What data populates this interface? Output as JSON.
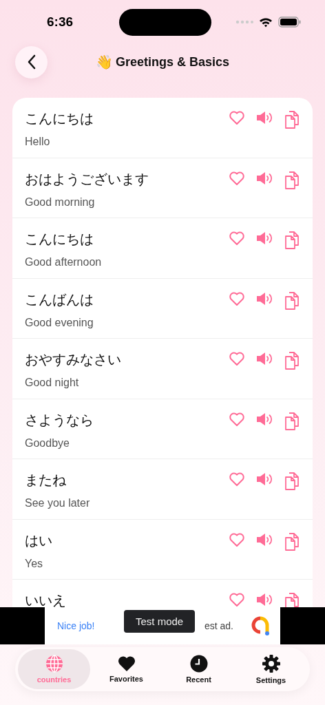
{
  "status_bar": {
    "time": "6:36"
  },
  "header": {
    "emoji": "👋",
    "title": "Greetings & Basics"
  },
  "phrases": [
    {
      "japanese": "こんにちは",
      "english": "Hello",
      "favorite": false
    },
    {
      "japanese": "おはようございます",
      "english": "Good morning",
      "favorite": false
    },
    {
      "japanese": "こんにちは",
      "english": "Good afternoon",
      "favorite": false
    },
    {
      "japanese": "こんばんは",
      "english": "Good evening",
      "favorite": false
    },
    {
      "japanese": "おやすみなさい",
      "english": "Good night",
      "favorite": false
    },
    {
      "japanese": "さようなら",
      "english": "Goodbye",
      "favorite": false
    },
    {
      "japanese": "またね",
      "english": "See you later",
      "favorite": false
    },
    {
      "japanese": "はい",
      "english": "Yes",
      "favorite": false
    },
    {
      "japanese": "いいえ",
      "favorite": false
    }
  ],
  "ad": {
    "headline": "Nice job!",
    "text": "est ad.",
    "badge": "Test mode"
  },
  "tabs": [
    {
      "label": "countries",
      "kind": "globe",
      "selected": true
    },
    {
      "label": "Favorites",
      "kind": "heart",
      "selected": false
    },
    {
      "label": "Recent",
      "kind": "clock",
      "selected": false
    },
    {
      "label": "Settings",
      "kind": "gear",
      "selected": false
    }
  ]
}
